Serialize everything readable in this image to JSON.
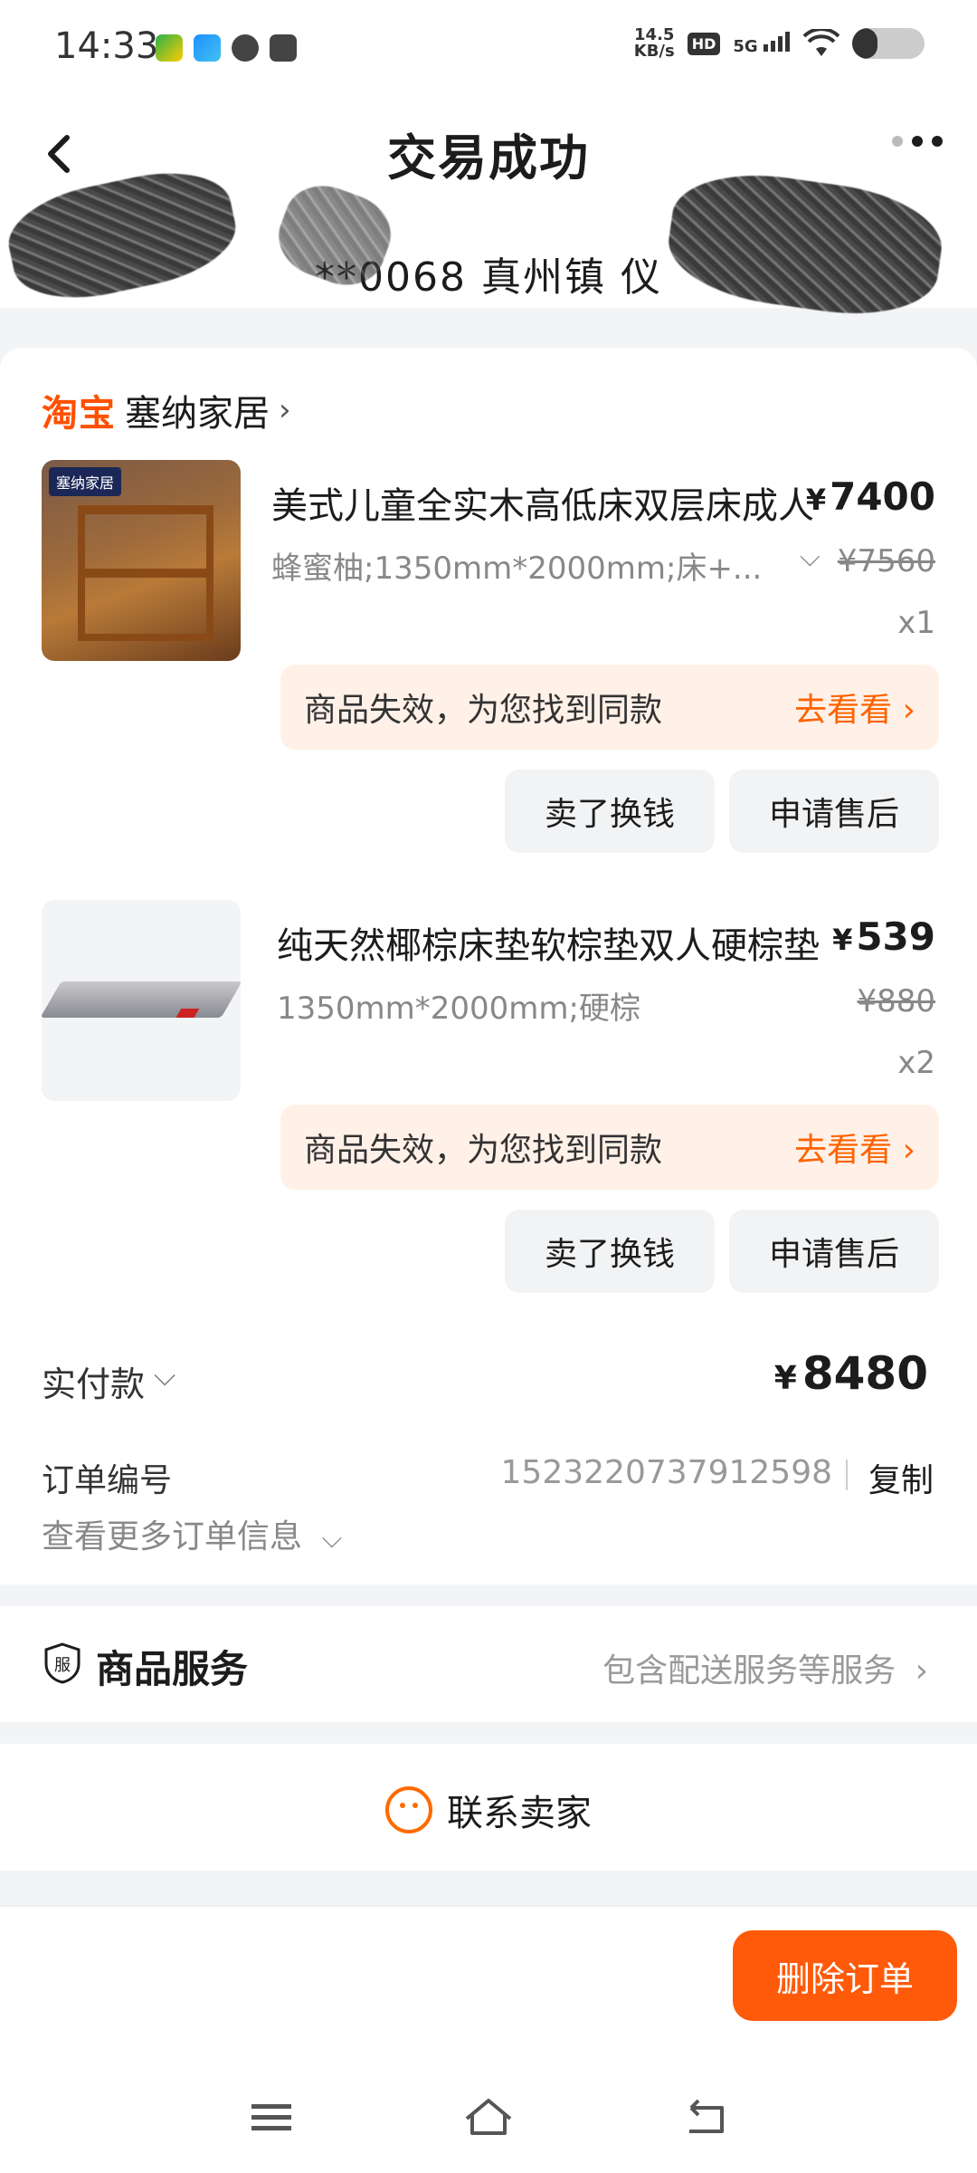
{
  "status_bar": {
    "time": "14:33",
    "net_speed": "14.5",
    "net_unit": "KB/s",
    "hd": "HD",
    "signal": "5G",
    "battery_level": 0.35
  },
  "header": {
    "title": "交易成功",
    "address_partial": "**0068  真州镇 仪"
  },
  "shop": {
    "platform": "淘宝",
    "name": "塞纳家居",
    "brand_tag": "塞纳家居"
  },
  "items": [
    {
      "title": "美式儿童全实木高低床双层床成人",
      "currency": "¥",
      "price": "7400",
      "spec": "蜂蜜柚;1350mm*2000mm;床+...",
      "original_price": "¥7560",
      "qty": "x1",
      "notice": "商品失效，为您找到同款",
      "notice_link": "去看看 ›",
      "btn_sell": "卖了换钱",
      "btn_after_sale": "申请售后"
    },
    {
      "title": "纯天然椰棕床垫软棕垫双人硬棕垫",
      "currency": "¥",
      "price": "539",
      "spec": "1350mm*2000mm;硬棕",
      "original_price": "¥880",
      "qty": "x2",
      "notice": "商品失效，为您找到同款",
      "notice_link": "去看看 ›",
      "btn_sell": "卖了换钱",
      "btn_after_sale": "申请售后"
    }
  ],
  "payment": {
    "label": "实付款",
    "currency": "¥",
    "amount": "8480"
  },
  "order": {
    "number_label": "订单编号",
    "number": "1523220737912598",
    "copy_label": "复制",
    "more_info": "查看更多订单信息"
  },
  "service": {
    "label": "商品服务",
    "icon_text": "服",
    "desc": "包含配送服务等服务"
  },
  "contact": {
    "label": "联系卖家"
  },
  "bottom": {
    "delete_label": "删除订单"
  },
  "colors": {
    "accent": "#ff5a0a",
    "taobao": "#ff5000",
    "notice_bg": "#fff1e8"
  }
}
